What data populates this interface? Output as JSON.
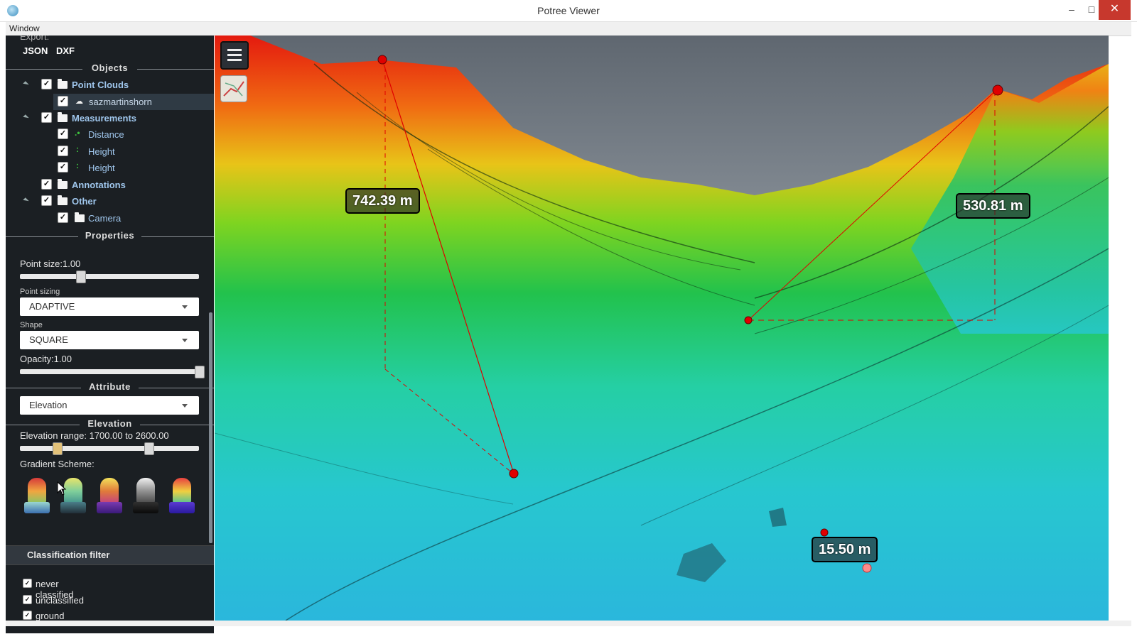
{
  "window": {
    "title": "Potree Viewer",
    "minimize": "–",
    "maximize": "□",
    "close": "✕"
  },
  "menubar": {
    "window": "Window"
  },
  "export": {
    "label": "Export:",
    "json": "JSON",
    "dxf": "DXF"
  },
  "objects": {
    "header": "Objects",
    "items": [
      {
        "label": "Point Clouds",
        "type": "folder",
        "checked": true,
        "bold": true
      },
      {
        "label": "sazmartinshorn",
        "type": "pointcloud",
        "checked": true,
        "selected": true
      },
      {
        "label": "Measurements",
        "type": "folder",
        "checked": true,
        "bold": true
      },
      {
        "label": "Distance",
        "type": "measurement",
        "checked": true
      },
      {
        "label": "Height",
        "type": "measurement",
        "checked": true
      },
      {
        "label": "Height",
        "type": "measurement",
        "checked": true
      },
      {
        "label": "Annotations",
        "type": "folder",
        "checked": true,
        "bold": true
      },
      {
        "label": "Other",
        "type": "folder",
        "checked": true,
        "bold": true
      },
      {
        "label": "Camera",
        "type": "folder",
        "checked": true
      }
    ]
  },
  "properties": {
    "header": "Properties",
    "point_size_label": "Point size:1.00",
    "point_size": 1.0,
    "point_sizing_label": "Point sizing",
    "point_sizing_value": "ADAPTIVE",
    "shape_label": "Shape",
    "shape_value": "SQUARE",
    "opacity_label": "Opacity:1.00",
    "opacity": 1.0
  },
  "attribute": {
    "header": "Attribute",
    "value": "Elevation"
  },
  "elevation": {
    "header": "Elevation",
    "range_label": "Elevation range: 1700.00 to 2600.00",
    "range_min": 1700.0,
    "range_max": 2600.0,
    "gradient_label": "Gradient Scheme:"
  },
  "classification": {
    "header": "Classification filter",
    "items": [
      {
        "label": "never classified",
        "checked": true
      },
      {
        "label": "unclassified",
        "checked": true
      },
      {
        "label": "ground",
        "checked": true
      }
    ]
  },
  "viewport": {
    "measurements": [
      {
        "label": "742.39 m"
      },
      {
        "label": "530.81 m"
      },
      {
        "label": "15.50 m"
      }
    ]
  },
  "colors": {
    "sidebar_bg": "#1b1f23",
    "tree_label": "#9fc6ec",
    "measure_point": "#e00000",
    "close_button": "#c7382d"
  },
  "icons": [
    "app-icon",
    "folder-icon",
    "pointcloud-icon",
    "measurement-icon",
    "menu-toggle-icon",
    "map-icon",
    "checkbox-icon"
  ]
}
